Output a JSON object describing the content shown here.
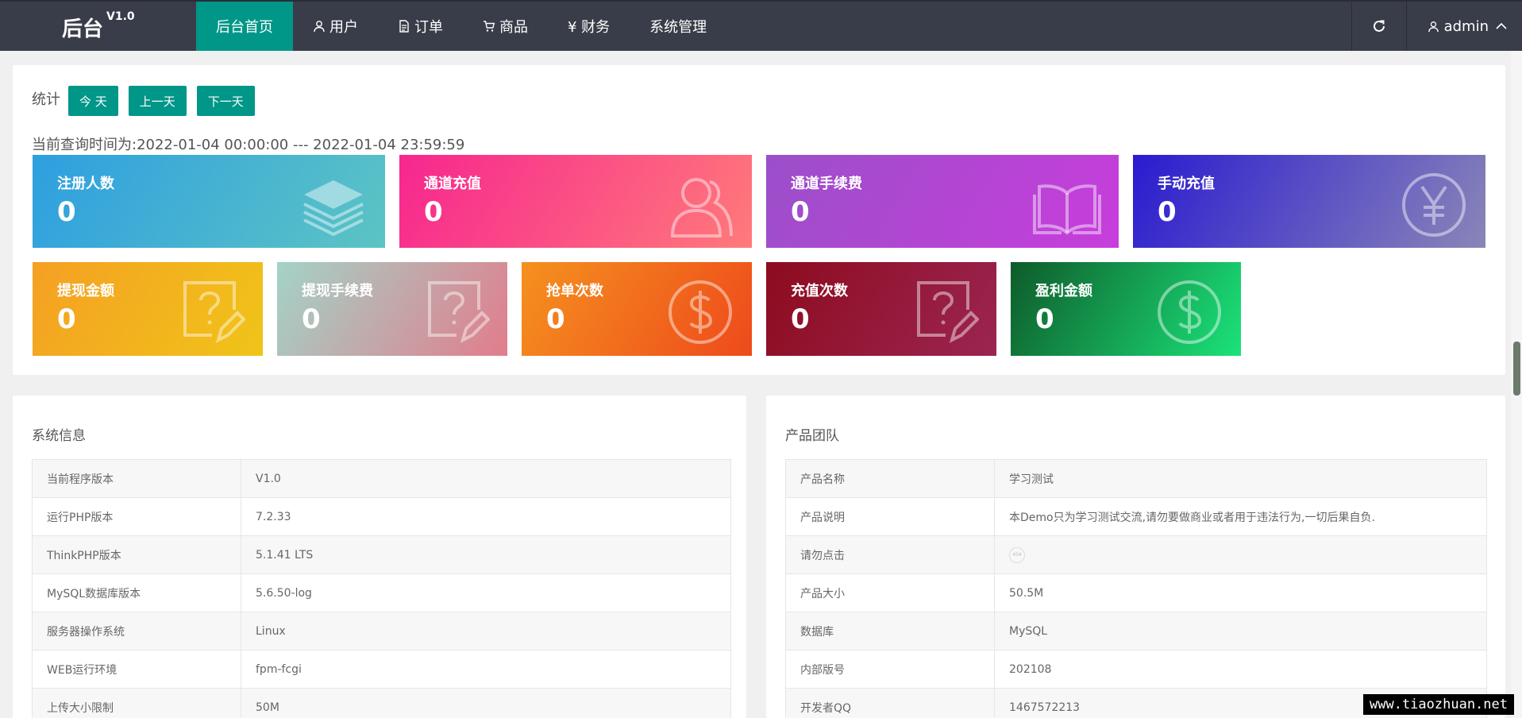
{
  "header": {
    "logo": "后台",
    "version": "V1.0",
    "nav": [
      {
        "label": "后台首页",
        "icon": "none"
      },
      {
        "label": "用户",
        "icon": "user-icon"
      },
      {
        "label": "订单",
        "icon": "document-icon"
      },
      {
        "label": "商品",
        "icon": "cart-icon"
      },
      {
        "label": "¥ 财务",
        "icon": "yen-icon"
      },
      {
        "label": "系统管理",
        "icon": "none"
      }
    ],
    "user": "admin"
  },
  "stats": {
    "label": "统计",
    "buttons": {
      "today": "今 天",
      "prev": "上一天",
      "next": "下一天"
    },
    "query_time": "当前查询时间为:2022-01-04 00:00:00 --- 2022-01-04 23:59:59",
    "cards": [
      {
        "title": "注册人数",
        "value": "0",
        "icon": "layers-icon",
        "gradient": [
          "#2e9fe0",
          "#5cc4c4"
        ]
      },
      {
        "title": "通道充值",
        "value": "0",
        "icon": "users-icon",
        "gradient": [
          "#f7268f",
          "#ff7a7a"
        ]
      },
      {
        "title": "通道手续费",
        "value": "0",
        "icon": "book-icon",
        "gradient": [
          "#9b4fc9",
          "#c83ddc"
        ]
      },
      {
        "title": "手动充值",
        "value": "0",
        "icon": "yen-circle-icon",
        "gradient": [
          "#2a1bd0",
          "#8a86b8"
        ]
      },
      {
        "title": "提现金额",
        "value": "0",
        "icon": "question-edit-icon",
        "gradient": [
          "#f5a023",
          "#f0c419"
        ]
      },
      {
        "title": "提现手续费",
        "value": "0",
        "icon": "question-edit-icon",
        "gradient": [
          "#a3d3c7",
          "#e17d8c"
        ]
      },
      {
        "title": "抢单次数",
        "value": "0",
        "icon": "dollar-circle-icon",
        "gradient": [
          "#f5911f",
          "#ee4a1b"
        ]
      },
      {
        "title": "充值次数",
        "value": "0",
        "icon": "question-edit-icon",
        "gradient": [
          "#8d0b1e",
          "#9b2552"
        ]
      },
      {
        "title": "盈利金额",
        "value": "0",
        "icon": "dollar-circle-icon",
        "gradient": [
          "#0e5b2a",
          "#1be37a"
        ]
      }
    ]
  },
  "system_info": {
    "title": "系统信息",
    "rows": [
      {
        "k": "当前程序版本",
        "v": "V1.0"
      },
      {
        "k": "运行PHP版本",
        "v": "7.2.33"
      },
      {
        "k": "ThinkPHP版本",
        "v": "5.1.41 LTS"
      },
      {
        "k": "MySQL数据库版本",
        "v": "5.6.50-log"
      },
      {
        "k": "服务器操作系统",
        "v": "Linux"
      },
      {
        "k": "WEB运行环境",
        "v": "fpm-fcgi"
      },
      {
        "k": "上传大小限制",
        "v": "50M"
      }
    ]
  },
  "product_team": {
    "title": "产品团队",
    "rows": [
      {
        "k": "产品名称",
        "v": "学习测试"
      },
      {
        "k": "产品说明",
        "v": "本Demo只为学习测试交流,请勿要做商业或者用于违法行为,一切后果自负."
      },
      {
        "k": "请勿点击",
        "v": "404"
      },
      {
        "k": "产品大小",
        "v": "50.5M"
      },
      {
        "k": "数据库",
        "v": "MySQL"
      },
      {
        "k": "内部版号",
        "v": "202108"
      },
      {
        "k": "开发者QQ",
        "v": "1467572213"
      }
    ]
  },
  "watermark": "www.tiaozhuan.net",
  "colors": {
    "header": "#393d49",
    "accent": "#009688"
  }
}
